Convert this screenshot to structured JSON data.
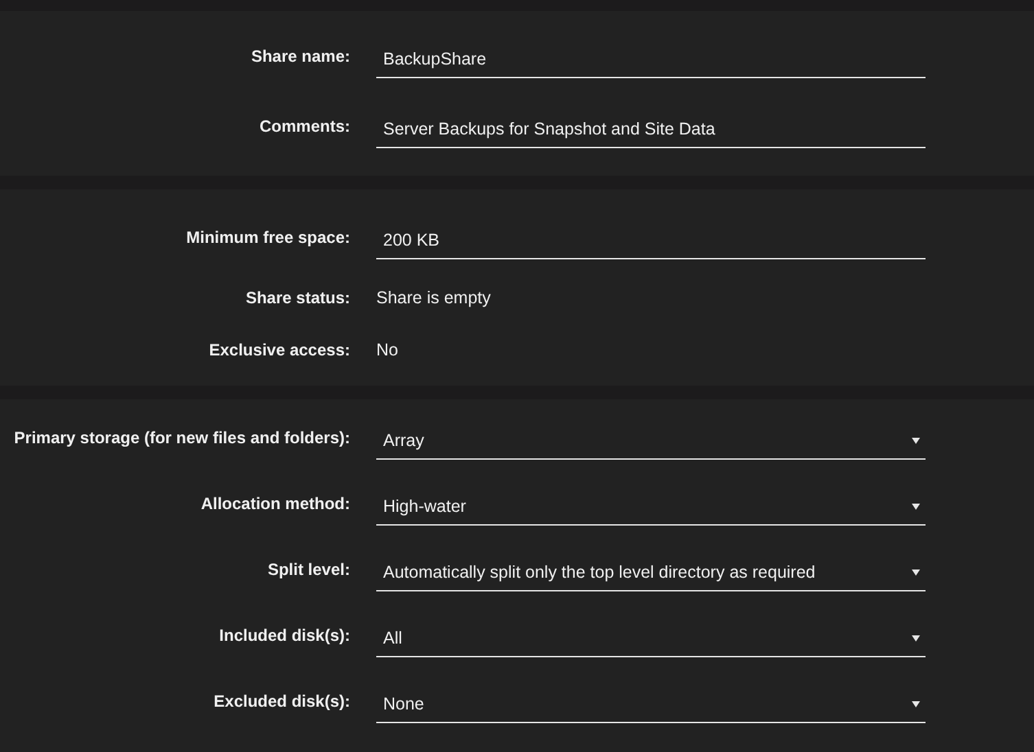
{
  "sections": [
    {
      "rows": [
        {
          "kind": "input",
          "label": "Share name:",
          "value": "BackupShare"
        },
        {
          "kind": "input",
          "label": "Comments:",
          "value": "Server Backups for Snapshot and Site Data"
        }
      ]
    },
    {
      "rows": [
        {
          "kind": "input",
          "label": "Minimum free space:",
          "value": "200 KB"
        },
        {
          "kind": "text",
          "label": "Share status:",
          "value": "Share is empty"
        },
        {
          "kind": "text",
          "label": "Exclusive access:",
          "value": "No"
        }
      ]
    },
    {
      "rows": [
        {
          "kind": "select",
          "label": "Primary storage (for new files and folders):",
          "value": "Array"
        },
        {
          "kind": "select",
          "label": "Allocation method:",
          "value": "High-water"
        },
        {
          "kind": "select",
          "label": "Split level:",
          "value": "Automatically split only the top level directory as required"
        },
        {
          "kind": "select",
          "label": "Included disk(s):",
          "value": "All"
        },
        {
          "kind": "select",
          "label": "Excluded disk(s):",
          "value": "None"
        }
      ]
    }
  ]
}
